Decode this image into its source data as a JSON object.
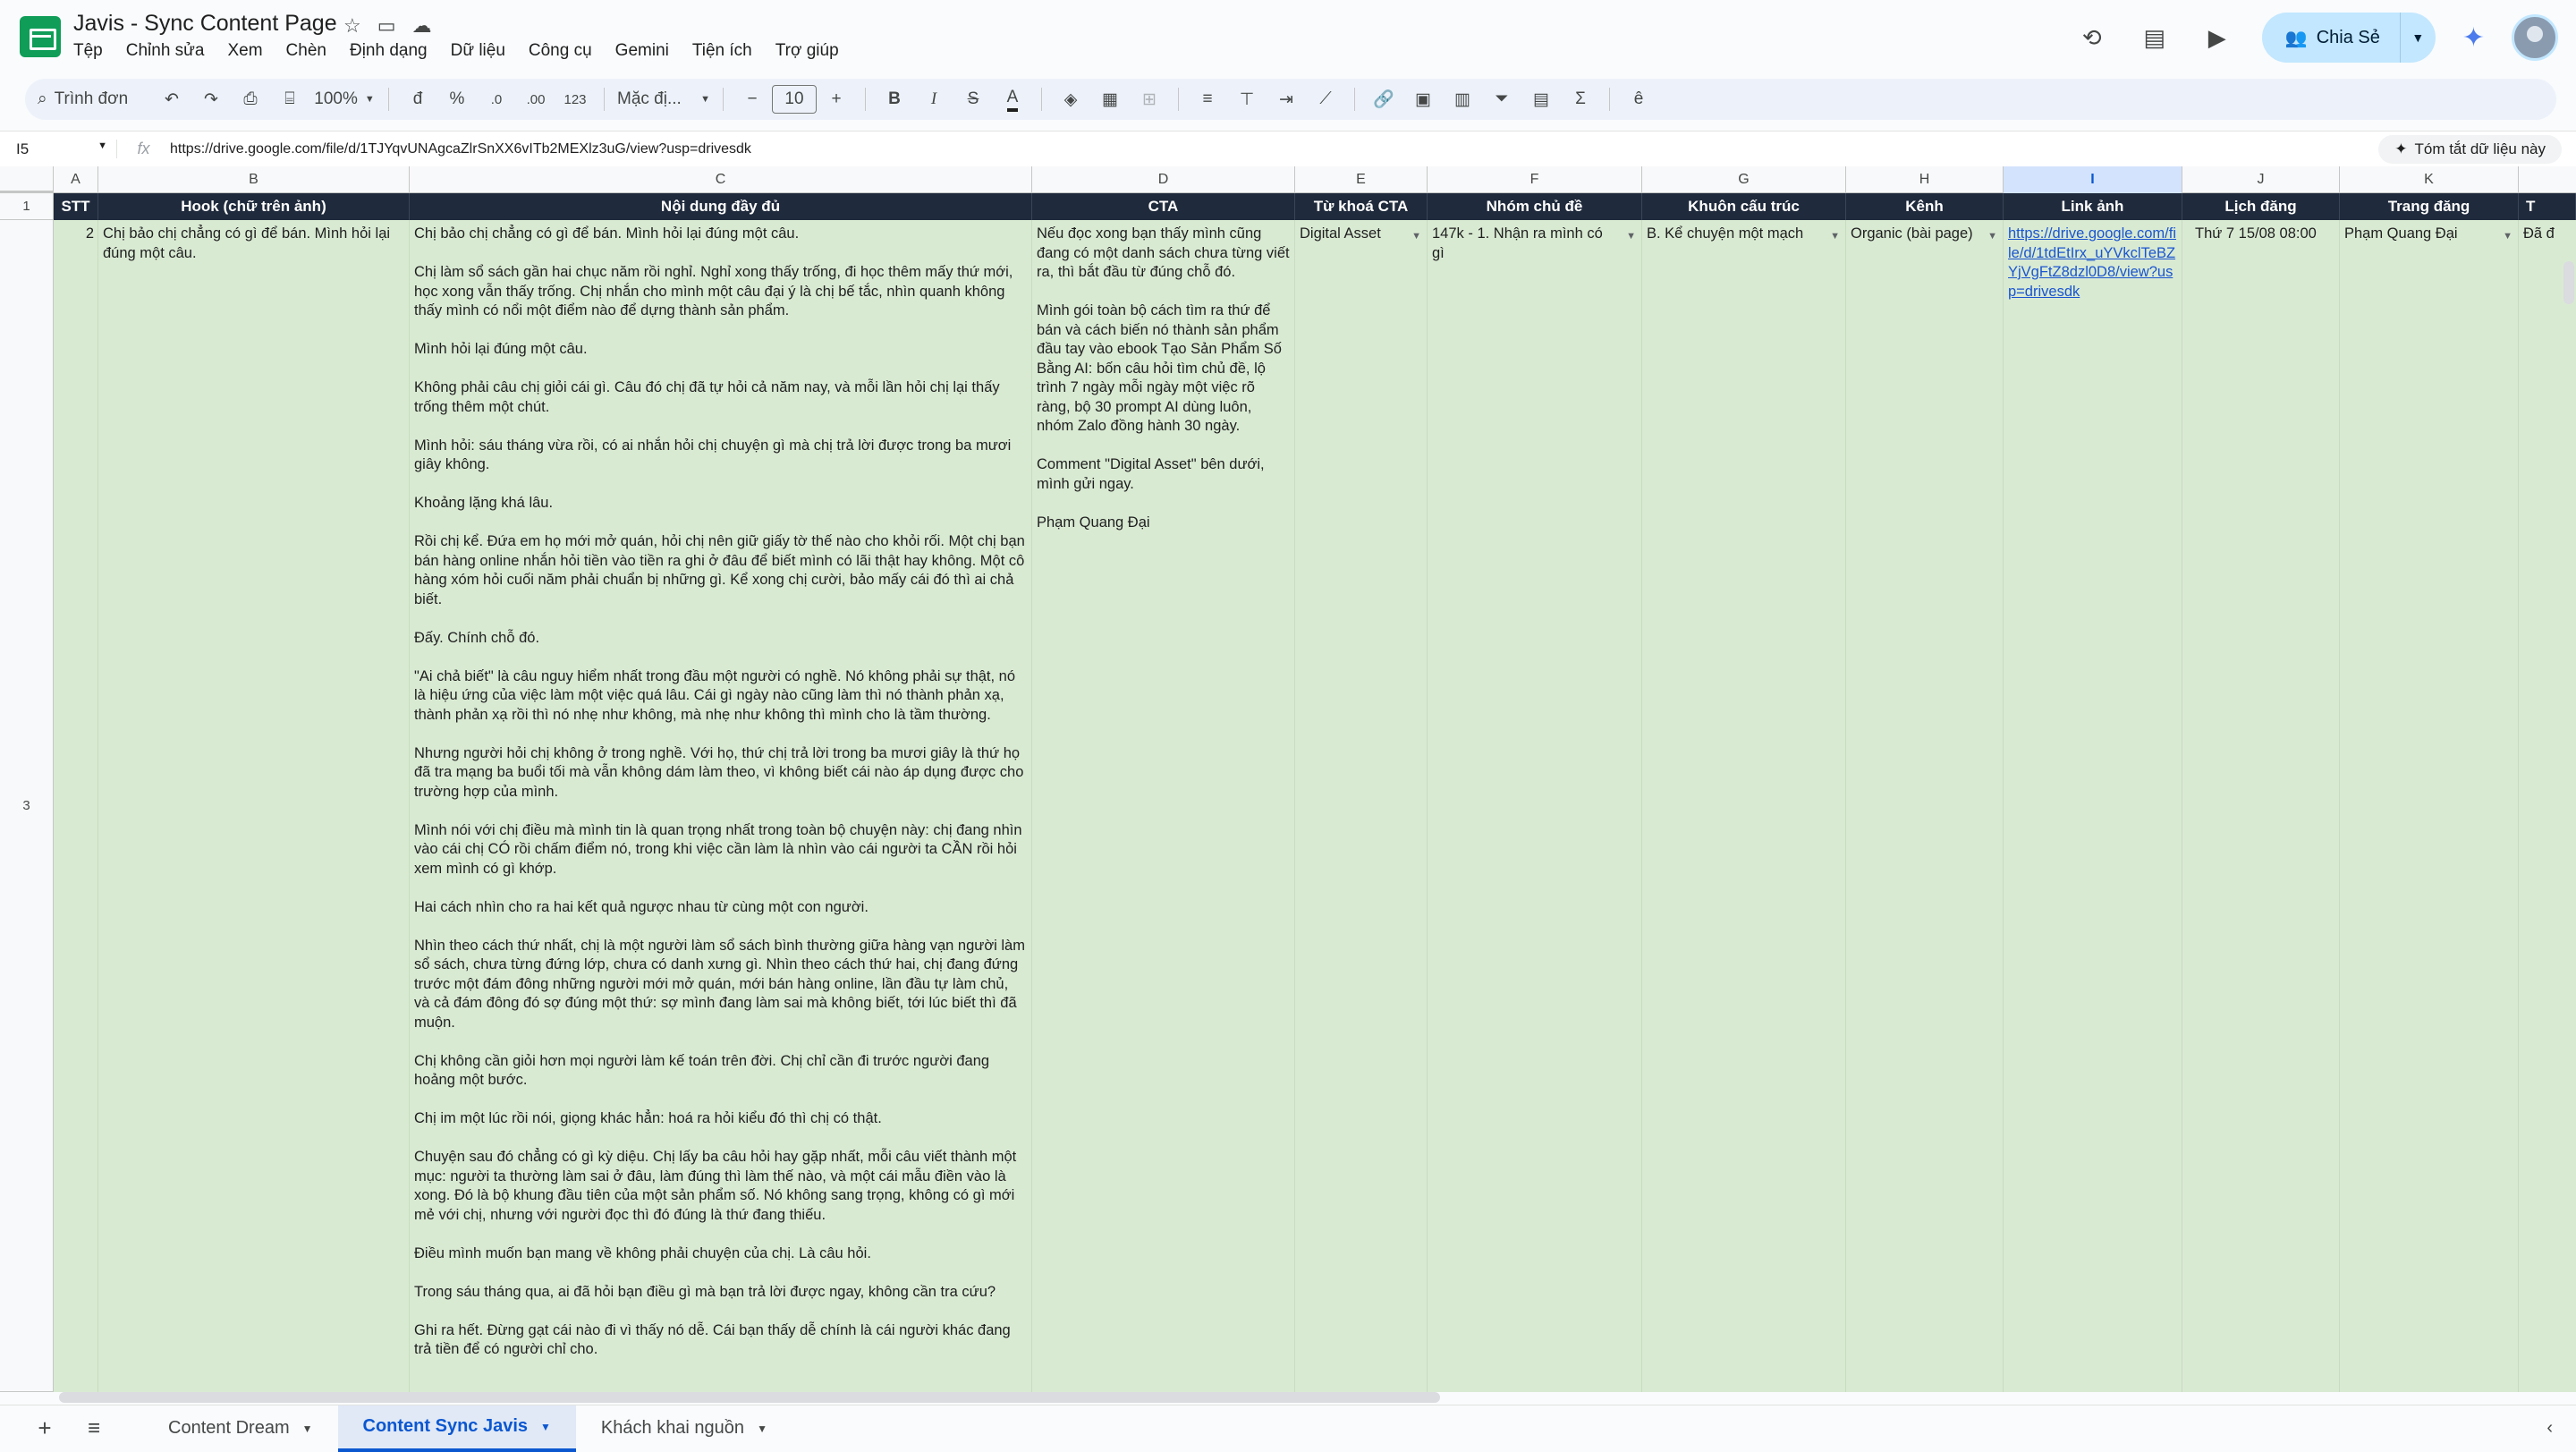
{
  "app": {
    "title": "Javis - Sync Content Page",
    "menu": [
      "Tệp",
      "Chỉnh sửa",
      "Xem",
      "Chèn",
      "Định dạng",
      "Dữ liệu",
      "Công cụ",
      "Gemini",
      "Tiện ích",
      "Trợ giúp"
    ],
    "share_label": "Chia Sẻ"
  },
  "toolbar": {
    "search_placeholder": "Trình đơn",
    "zoom": "100%",
    "currency": "đ",
    "percent": "%",
    "dec_decrease": ".0",
    "dec_increase": ".00",
    "number_format": "123",
    "font": "Mặc đị...",
    "font_size": "10",
    "bold": "B",
    "italic": "I",
    "strike": "S",
    "text_color": "A",
    "sum": "Σ"
  },
  "formula_bar": {
    "cell_ref": "I5",
    "fx": "fx",
    "value": "https://drive.google.com/file/d/1TJYqvUNAgcaZlrSnXX6vITb2MEXlz3uG/view?usp=drivesdk",
    "summary_label": "Tóm tắt dữ liệu này"
  },
  "columns": [
    {
      "letter": "A",
      "header": "STT"
    },
    {
      "letter": "B",
      "header": "Hook (chữ trên ảnh)"
    },
    {
      "letter": "C",
      "header": "Nội dung đầy đủ"
    },
    {
      "letter": "D",
      "header": "CTA"
    },
    {
      "letter": "E",
      "header": "Từ khoá CTA"
    },
    {
      "letter": "F",
      "header": "Nhóm chủ đề"
    },
    {
      "letter": "G",
      "header": "Khuôn cấu trúc"
    },
    {
      "letter": "H",
      "header": "Kênh"
    },
    {
      "letter": "I",
      "header": "Link ảnh"
    },
    {
      "letter": "J",
      "header": "Lịch đăng"
    },
    {
      "letter": "K",
      "header": "Trang đăng"
    },
    {
      "letter": "L",
      "header": "T"
    }
  ],
  "row_numbers": [
    "1",
    "3"
  ],
  "row": {
    "stt": "2",
    "hook": "Chị bảo chị chẳng có gì để bán. Mình hỏi lại đúng một câu.",
    "content": [
      "Chị bảo chị chẳng có gì để bán. Mình hỏi lại đúng một câu.",
      "Chị làm sổ sách gần hai chục năm rồi nghỉ. Nghỉ xong thấy trống, đi học thêm mấy thứ mới, học xong vẫn thấy trống. Chị nhắn cho mình một câu đại ý là chị bế tắc, nhìn quanh không thấy mình có nổi một điểm nào để dựng thành sản phẩm.",
      "Mình hỏi lại đúng một câu.",
      "Không phải câu chị giỏi cái gì. Câu đó chị đã tự hỏi cả năm nay, và mỗi lần hỏi chị lại thấy trống thêm một chút.",
      "Mình hỏi: sáu tháng vừa rồi, có ai nhắn hỏi chị chuyện gì mà chị trả lời được trong ba mươi giây không.",
      "Khoảng lặng khá lâu.",
      "Rồi chị kể. Đứa em họ mới mở quán, hỏi chị nên giữ giấy tờ thế nào cho khỏi rối. Một chị bạn bán hàng online nhắn hỏi tiền vào tiền ra ghi ở đâu để biết mình có lãi thật hay không. Một cô hàng xóm hỏi cuối năm phải chuẩn bị những gì. Kể xong chị cười, bảo mấy cái đó thì ai chả biết.",
      "Đấy. Chính chỗ đó.",
      "\"Ai chả biết\" là câu nguy hiểm nhất trong đầu một người có nghề. Nó không phải sự thật, nó là hiệu ứng của việc làm một việc quá lâu. Cái gì ngày nào cũng làm thì nó thành phản xạ, thành phản xạ rồi thì nó nhẹ như không, mà nhẹ như không thì mình cho là tầm thường.",
      "Nhưng người hỏi chị không ở trong nghề. Với họ, thứ chị trả lời trong ba mươi giây là thứ họ đã tra mạng ba buổi tối mà vẫn không dám làm theo, vì không biết cái nào áp dụng được cho trường hợp của mình.",
      "Mình nói với chị điều mà mình tin là quan trọng nhất trong toàn bộ chuyện này: chị đang nhìn vào cái chị CÓ rồi chấm điểm nó, trong khi việc cần làm là nhìn vào cái người ta CẦN rồi hỏi xem mình có gì khớp.",
      "Hai cách nhìn cho ra hai kết quả ngược nhau từ cùng một con người.",
      "Nhìn theo cách thứ nhất, chị là một người làm sổ sách bình thường giữa hàng vạn người làm sổ sách, chưa từng đứng lớp, chưa có danh xưng gì. Nhìn theo cách thứ hai, chị đang đứng trước một đám đông những người mới mở quán, mới bán hàng online, lần đầu tự làm chủ, và cả đám đông đó sợ đúng một thứ: sợ mình đang làm sai mà không biết, tới lúc biết thì đã muộn.",
      "Chị không cần giỏi hơn mọi người làm kế toán trên đời. Chị chỉ cần đi trước người đang hoảng một bước.",
      "Chị im một lúc rồi nói, giọng khác hẳn: hoá ra hỏi kiểu đó thì chị có thật.",
      "Chuyện sau đó chẳng có gì kỳ diệu. Chị lấy ba câu hỏi hay gặp nhất, mỗi câu viết thành một mục: người ta thường làm sai ở đâu, làm đúng thì làm thế nào, và một cái mẫu điền vào là xong. Đó là bộ khung đầu tiên của một sản phẩm số. Nó không sang trọng, không có gì mới mẻ với chị, nhưng với người đọc thì đó đúng là thứ đang thiếu.",
      "Điều mình muốn bạn mang về không phải chuyện của chị. Là câu hỏi.",
      "Trong sáu tháng qua, ai đã hỏi bạn điều gì mà bạn trả lời được ngay, không cần tra cứu?",
      "Ghi ra hết. Đừng gạt cái nào đi vì thấy nó dễ. Cái bạn thấy dễ chính là cái người khác đang trả tiền để có người chỉ cho."
    ],
    "cta": [
      "Nếu đọc xong bạn thấy mình cũng đang có một danh sách chưa từng viết ra, thì bắt đầu từ đúng chỗ đó.",
      "Mình gói toàn bộ cách tìm ra thứ để bán và cách biến nó thành sản phẩm đầu tay vào ebook Tạo Sản Phẩm Số Bằng AI: bốn câu hỏi tìm chủ đề, lộ trình 7 ngày mỗi ngày một việc rõ ràng, bộ 30 prompt AI dùng luôn, nhóm Zalo đồng hành 30 ngày.",
      "Comment \"Digital Asset\" bên dưới, mình gửi ngay.",
      "Phạm Quang Đại"
    ],
    "keyword": "Digital Asset",
    "topic": "147k - 1. Nhận ra mình có gì",
    "structure": "B. Kể chuyện một mạch",
    "channel": "Organic (bài page)",
    "image_link": "https://drive.google.com/file/d/1tdEtIrx_uYVkclTeBZYjVgFtZ8dzl0D8/view?usp=drivesdk",
    "schedule": "Thứ 7 15/08 08:00",
    "page": "Phạm Quang Đại",
    "last_col": "Đã đ"
  },
  "tabs": [
    "Content Dream",
    "Content Sync Javis",
    "Khách khai nguồn"
  ],
  "active_tab": "Content Sync Javis",
  "colors": {
    "header_fill": "#1f2a3c",
    "row_fill": "#d9ead3",
    "accent": "#0b57d0",
    "share_fill": "#c2e7ff"
  }
}
